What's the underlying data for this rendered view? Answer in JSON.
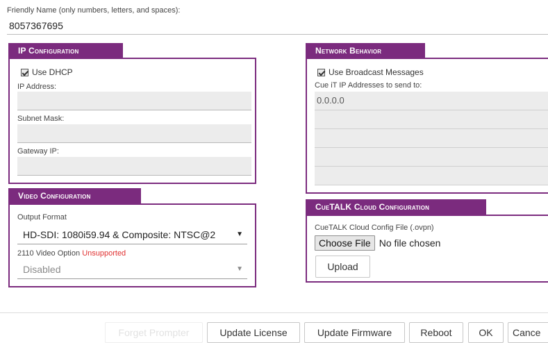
{
  "friendly": {
    "label": "Friendly Name (only numbers, letters, and spaces):",
    "value": "8057367695"
  },
  "ip_config": {
    "title": "IP Configuration",
    "use_dhcp_label": "Use DHCP",
    "use_dhcp_checked": true,
    "ip_address_label": "IP Address:",
    "ip_address_value": "",
    "subnet_label": "Subnet Mask:",
    "subnet_value": "",
    "gateway_label": "Gateway IP:",
    "gateway_value": ""
  },
  "video_config": {
    "title": "Video Configuration",
    "output_format_label": "Output Format",
    "output_format_value": "HD-SDI: 1080i59.94 & Composite: NTSC@2",
    "option_2110_label": "2110 Video Option",
    "option_2110_status": "Unsupported",
    "option_2110_value": "Disabled"
  },
  "network_behavior": {
    "title": "Network Behavior",
    "broadcast_label": "Use Broadcast Messages",
    "broadcast_checked": true,
    "addresses_label": "Cue iT IP Addresses to send to:",
    "addresses": [
      "0.0.0.0",
      "",
      "",
      "",
      ""
    ]
  },
  "cuetalk": {
    "title": "CueTALK Cloud Configuration",
    "file_label": "CueTALK Cloud Config File (.ovpn)",
    "choose_file_label": "Choose File",
    "no_file_text": "No file chosen",
    "upload_label": "Upload"
  },
  "footer": {
    "forget_label": "Forget Prompter",
    "update_license_label": "Update License",
    "update_firmware_label": "Update Firmware",
    "reboot_label": "Reboot",
    "ok_label": "OK",
    "cancel_label": "Cance"
  },
  "colors": {
    "accent": "#7b2b7e",
    "field_bg": "#ececec",
    "error": "#e03030"
  }
}
